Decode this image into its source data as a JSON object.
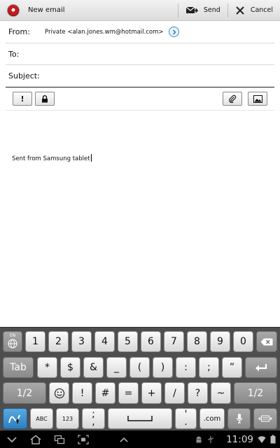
{
  "topbar": {
    "title": "New email",
    "send_label": "Send",
    "cancel_label": "Cancel"
  },
  "form": {
    "from_label": "From:",
    "from_value": "Private <alan.jones.wm@hotmail.com>",
    "to_label": "To:",
    "to_value": "",
    "subject_label": "Subject:",
    "subject_value": ""
  },
  "toolbar": {
    "priority_label": "!"
  },
  "body": {
    "text": "Sent from Samsung tablet"
  },
  "keyboard": {
    "lang": "EN",
    "row1": [
      "1",
      "2",
      "3",
      "4",
      "5",
      "6",
      "7",
      "8",
      "9",
      "0"
    ],
    "row2_tab": "Tab",
    "row2": [
      "*",
      "$",
      "&",
      "_",
      "(",
      ")",
      ":",
      ";",
      "”"
    ],
    "row3_shift": "1/2",
    "row3": [
      "!",
      "#",
      "=",
      "+",
      "/",
      "?",
      "~"
    ],
    "row3_shift_right": "1/2",
    "abc": "ABC",
    "num": "123",
    "semicolon": ";",
    "comma": ",",
    "apostrophe": "'",
    "period": ".",
    "dotcom": ".com"
  },
  "status": {
    "time": "11:09"
  },
  "colors": {
    "keyboard_bg": "#4e4e4e",
    "accent": "#3a8dc9"
  }
}
